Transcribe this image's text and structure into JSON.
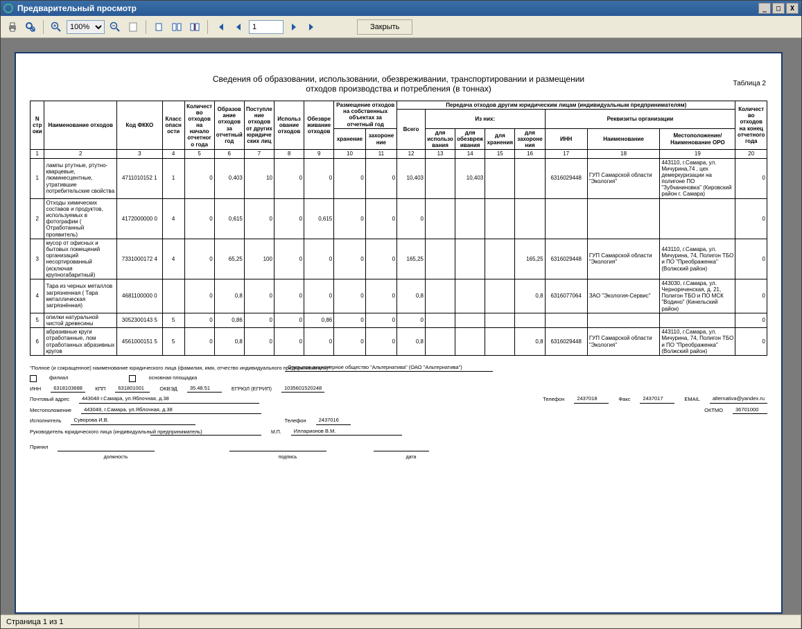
{
  "window": {
    "title": "Предварительный просмотр",
    "status": "Страница 1 из 1"
  },
  "toolbar": {
    "zoom": "100%",
    "page_value": "1",
    "close_label": "Закрыть"
  },
  "report": {
    "title_line1": "Сведения об образовании, использовании, обезвреживании, транспортировании и размещении",
    "title_line2": "отходов производства и потребления (в тоннах)",
    "table_label": "Таблица 2"
  },
  "headers": {
    "col1": "N строки",
    "col2": "Наименование отходов",
    "col3": "Код ФККО",
    "col4": "Класс опасности",
    "col5": "Количество отходов на начало отчетного года",
    "col6": "Образование отходов за отчетный год",
    "col7": "Поступление отходов от других юридических лиц",
    "col8": "Использование отходов",
    "col9": "Обезвреживание отходов",
    "col10g": "Размещение отходов на собственных объектах за отчетный год",
    "col10": "хранение",
    "col11": "захоронение",
    "col12g": "Передача отходов другим юридическим лицам (индивидуальным предпринимателям)",
    "col12": "Всего",
    "col12sub": "Из них:",
    "col13": "для использования",
    "col14": "для обезвреживания",
    "col15": "для хранения",
    "col16": "для захоронения",
    "col17g": "Реквизиты организации",
    "col17": "ИНН",
    "col18": "Наименование",
    "col19": "Местоположение/ Наименование ОРО",
    "col20": "Количество отходов на конец отчетного года"
  },
  "colnums": [
    "1",
    "2",
    "3",
    "4",
    "5",
    "6",
    "7",
    "8",
    "9",
    "10",
    "11",
    "12",
    "13",
    "14",
    "15",
    "16",
    "17",
    "18",
    "19",
    "20"
  ],
  "rows": [
    {
      "n": "1",
      "name": "лампы ртутные, ртутно-кварцевые, люминесцентные, утратившие потребительские свойства",
      "code": "4711010152 1",
      "klass": "1",
      "c5": "0",
      "c6": "0,403",
      "c7": "10",
      "c8": "0",
      "c9": "0",
      "c10": "0",
      "c11": "0",
      "c12": "10,403",
      "c13": "",
      "c14": "10,403",
      "c15": "",
      "c16": "",
      "inn": "6316029448",
      "org": "ГУП Самарской области \"Экология\"",
      "loc": "443110, г.Самара, ул. Мичурина,74 , цех демеркуризации на полигоне ПО \"Зубчаниновка\" (Кировский район г. Самара)",
      "c20": "0"
    },
    {
      "n": "2",
      "name": "Отходы химических составов и продуктов, используемых в фотографии ( Отработанный проявитель)",
      "code": "4172000000 0",
      "klass": "4",
      "c5": "0",
      "c6": "0,615",
      "c7": "0",
      "c8": "0",
      "c9": "0,615",
      "c10": "0",
      "c11": "0",
      "c12": "0",
      "c13": "",
      "c14": "",
      "c15": "",
      "c16": "",
      "inn": "",
      "org": "",
      "loc": "",
      "c20": "0"
    },
    {
      "n": "3",
      "name": "мусор от офисных и бытовых помещений организаций несортированный (исключая крупногабаритный)",
      "code": "7331000172 4",
      "klass": "4",
      "c5": "0",
      "c6": "65,25",
      "c7": "100",
      "c8": "0",
      "c9": "0",
      "c10": "0",
      "c11": "0",
      "c12": "165,25",
      "c13": "",
      "c14": "",
      "c15": "",
      "c16": "165,25",
      "inn": "6316029448",
      "org": "ГУП Самарской области \"Экология\"",
      "loc": "443110, г.Самара, ул. Мичурина, 74, Полигон ТБО и ПО \"Преображенка\"(Волжский район)",
      "c20": "0"
    },
    {
      "n": "4",
      "name": "Тара из черных металлов загрязненная ( Тара металлическая загрязнённая)",
      "code": "4681100000 0",
      "klass": "",
      "c5": "0",
      "c6": "0,8",
      "c7": "0",
      "c8": "0",
      "c9": "0",
      "c10": "0",
      "c11": "0",
      "c12": "0,8",
      "c13": "",
      "c14": "",
      "c15": "",
      "c16": "0,8",
      "inn": "6316077064",
      "org": "ЗАО \"Экология-Сервис\"",
      "loc": "443030, г.Самара, ул. Чернореченская, д. 21, Полигон ТБО и ПО МСК \"Водино\" (Кинельский район)",
      "c20": "0"
    },
    {
      "n": "5",
      "name": "опилки натуральной чистой древесины",
      "code": "3052300143 5",
      "klass": "5",
      "c5": "0",
      "c6": "0,86",
      "c7": "0",
      "c8": "0",
      "c9": "0,86",
      "c10": "0",
      "c11": "0",
      "c12": "0",
      "c13": "",
      "c14": "",
      "c15": "",
      "c16": "",
      "inn": "",
      "org": "",
      "loc": "",
      "c20": "0"
    },
    {
      "n": "6",
      "name": "абразивные круги отработанные, лом отработанных абразивных кругов",
      "code": "4561000151 5",
      "klass": "5",
      "c5": "0",
      "c6": "0,8",
      "c7": "0",
      "c8": "0",
      "c9": "0",
      "c10": "0",
      "c11": "0",
      "c12": "0,8",
      "c13": "",
      "c14": "",
      "c15": "",
      "c16": "0,8",
      "inn": "6316029448",
      "org": "ГУП Самарской области \"Экология\"",
      "loc": "443110, г.Самара, ул. Мичурина, 74, Полигон ТБО и ПО \"Преображенка\"(Волжский район)",
      "c20": "0"
    }
  ],
  "footer": {
    "note1": "\"Полное (и сокращенное) наименование юридического лица (фамилия, имя, отчество индивидуального предпринимателя)\"",
    "org_full": "Открытое акционерное общество \"Альтернатива\" (ОАО \"Альтернатива\")",
    "filial": "филиал",
    "osn_pl": "основная площадка",
    "inn_lbl": "ИНН",
    "inn": "6318103688",
    "kpp_lbl": "КПП",
    "kpp": "631801001",
    "okved_lbl": "ОКВЭД",
    "okved": "35.48.51",
    "egr_lbl": "ЕГРЮЛ (ЕГРИП)",
    "egr": "1035601520248",
    "addr_lbl": "Почтовый адрес",
    "addr": "443048    г.Самара, ул.Яблочная, д.38",
    "tel_lbl": "Телефон",
    "tel": "2437018",
    "fax_lbl": "Факс",
    "fax": "2437017",
    "email_lbl": "EMAIL",
    "email": "alternativa@yandex.ru",
    "loc_lbl": "Местоположение",
    "loc": "443048, г.Самара, ул.Яблочная, д.38",
    "oktmo_lbl": "ОКТМО",
    "oktmo": "36701000",
    "isp_lbl": "Исполнитель",
    "isp": "Суворова И.В.",
    "isp_tel": "2437016",
    "ruk_lbl": "Руководитель юридического лица (индивидуальный предприниматель)",
    "ruk": "Илларионов В.М.",
    "mp": "М.П.",
    "pri": "Принял",
    "dolzh": "должность",
    "podp": "подпись",
    "data": "дата"
  }
}
